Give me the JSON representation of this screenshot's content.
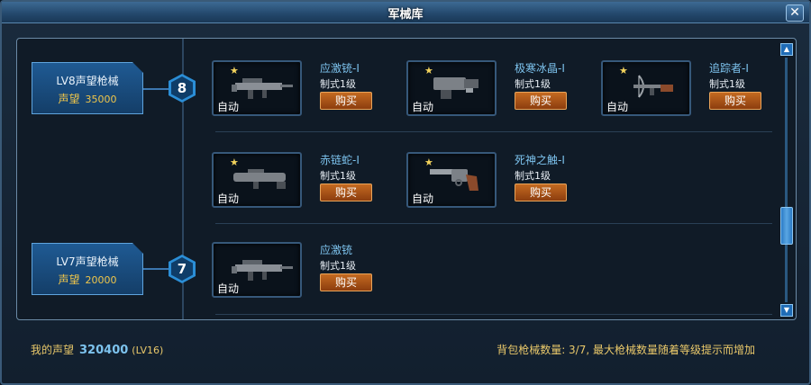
{
  "window": {
    "title": "军械库",
    "close_label": "✕"
  },
  "levels": [
    {
      "title": "LV8声望枪械",
      "rep_label": "声望",
      "rep_value": "35000",
      "number": "8"
    },
    {
      "title": "LV7声望枪械",
      "rep_label": "声望",
      "rep_value": "20000",
      "number": "7"
    }
  ],
  "items": [
    {
      "name": "应激铳-Ⅰ",
      "type": "制式1级",
      "buy": "购买",
      "auto": "自动",
      "icon": "assault-rifle-icon"
    },
    {
      "name": "极寒冰晶-Ⅰ",
      "type": "制式1级",
      "buy": "购买",
      "auto": "自动",
      "icon": "ice-cannon-icon"
    },
    {
      "name": "追踪者-Ⅰ",
      "type": "制式1级",
      "buy": "购买",
      "auto": "自动",
      "icon": "crossbow-icon"
    },
    {
      "name": "赤链蛇-Ⅰ",
      "type": "制式1级",
      "buy": "购买",
      "auto": "自动",
      "icon": "launcher-icon"
    },
    {
      "name": "死神之触-Ⅰ",
      "type": "制式1级",
      "buy": "购买",
      "auto": "自动",
      "icon": "revolver-icon"
    },
    {
      "name": "应激铳",
      "type": "制式1级",
      "buy": "购买",
      "auto": "自动",
      "icon": "assault-rifle-icon"
    }
  ],
  "footer": {
    "my_rep_label": "我的声望",
    "my_rep_value": "320400",
    "my_level": "(LV16)",
    "capacity_text": "背包枪械数量: 3/7, 最大枪械数量随着等级提示而增加"
  },
  "scrollbar": {
    "up": "▲",
    "down": "▼",
    "position": 0.72
  },
  "colors": {
    "accent": "#2b8ed6",
    "buy_button": "#c46a21",
    "gold_text": "#e9c86a",
    "item_name": "#7dc3ee"
  }
}
